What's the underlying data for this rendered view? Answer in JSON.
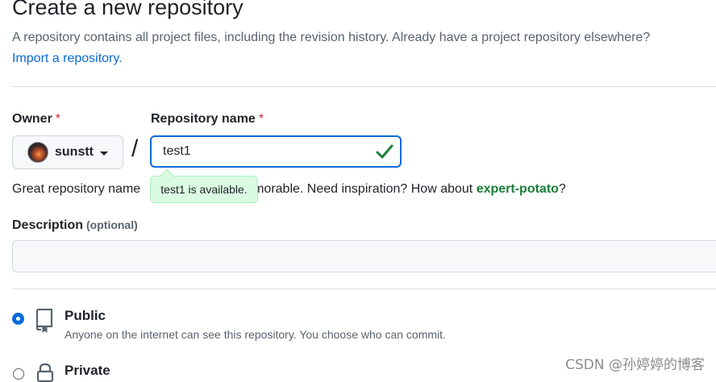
{
  "header": {
    "title": "Create a new repository",
    "subtitle": "A repository contains all project files, including the revision history. Already have a project repository elsewhere?",
    "import_link": "Import a repository."
  },
  "owner": {
    "label": "Owner",
    "required_mark": "*",
    "selected": "sunstt"
  },
  "repo": {
    "label": "Repository name",
    "required_mark": "*",
    "value": "test1",
    "slash": "/",
    "availability_tooltip": "test1 is available.",
    "hint_prefix": "Great repository name",
    "hint_middle": "emorable. Need inspiration? How about",
    "suggestion": "expert-potato",
    "hint_suffix": "?"
  },
  "description": {
    "label": "Description",
    "optional": "(optional)",
    "value": ""
  },
  "visibility": {
    "options": [
      {
        "title": "Public",
        "desc": "Anyone on the internet can see this repository. You choose who can commit.",
        "checked": true
      },
      {
        "title": "Private",
        "desc": "",
        "checked": false
      }
    ]
  },
  "watermark": "CSDN @孙婷婷的博客",
  "colors": {
    "accent": "#0969da",
    "success": "#1a7f37",
    "danger": "#d1242f"
  }
}
